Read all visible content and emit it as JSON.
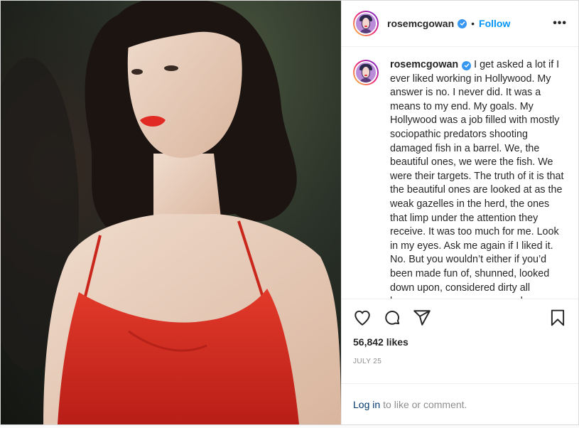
{
  "post": {
    "username": "rosemcgowan",
    "verified": true,
    "separator": "•",
    "follow_label": "Follow",
    "more_label": "•••",
    "caption": "I get asked a lot if I ever liked working in Hollywood. My answer is no. I never did. It was a means to my end. My goals. My Hollywood was a job filled with mostly sociopathic predators shooting damaged fish in a barrel. We, the beautiful ones, we were the fish. We were their targets. The truth of it is that the beautiful ones are looked at as the weak gazelles in the herd, the ones that limp under the attention they receive. It was too much for me. Look in my eyes. Ask me again if I liked it. No. But you wouldn’t either if you’d been made fun of, shunned, looked down upon, considered dirty all because someone everyone knew as King Predator and a total piece of shit",
    "likes": "56,842 likes",
    "date": "JULY 25",
    "login_link": "Log in",
    "login_text": "to like or comment."
  },
  "icons": {
    "like": "heart-icon",
    "comment": "comment-icon",
    "share": "share-icon",
    "save": "bookmark-icon",
    "verified": "verified-badge-icon"
  },
  "colors": {
    "follow": "#0095f6",
    "verified": "#3897f0",
    "dress": "#d92a1f"
  }
}
